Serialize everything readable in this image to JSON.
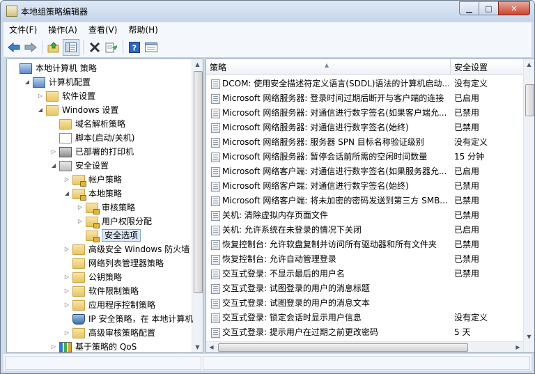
{
  "window": {
    "title": "本地组策略编辑器"
  },
  "menu": [
    "文件(F)",
    "操作(A)",
    "查看(V)",
    "帮助(H)"
  ],
  "toolbar": {
    "icons": [
      "back-arrow-icon",
      "forward-arrow-icon",
      "up-folder-icon",
      "show-hide-tree-icon",
      "delete-icon",
      "export-list-icon",
      "help-icon",
      "properties-view-icon"
    ]
  },
  "tree": [
    {
      "label": "本地计算机 策略",
      "level": 0,
      "icon": "computer",
      "toggle": ""
    },
    {
      "label": "计算机配置",
      "level": 1,
      "icon": "computer",
      "toggle": "◢"
    },
    {
      "label": "软件设置",
      "level": 2,
      "icon": "folder",
      "toggle": "▷"
    },
    {
      "label": "Windows 设置",
      "level": 2,
      "icon": "folder",
      "toggle": "◢"
    },
    {
      "label": "域名解析策略",
      "level": 3,
      "icon": "folder",
      "toggle": ""
    },
    {
      "label": "脚本(启动/关机)",
      "level": 3,
      "icon": "doc",
      "toggle": ""
    },
    {
      "label": "已部署的打印机",
      "level": 3,
      "icon": "printer",
      "toggle": "▷"
    },
    {
      "label": "安全设置",
      "level": 3,
      "icon": "lockdoc",
      "toggle": "◢"
    },
    {
      "label": "帐户策略",
      "level": 4,
      "icon": "lockfolder",
      "toggle": "▷"
    },
    {
      "label": "本地策略",
      "level": 4,
      "icon": "lockfolder",
      "toggle": "◢"
    },
    {
      "label": "审核策略",
      "level": 5,
      "icon": "lockfolder",
      "toggle": "▷"
    },
    {
      "label": "用户权限分配",
      "level": 5,
      "icon": "lockfolder",
      "toggle": "▷"
    },
    {
      "label": "安全选项",
      "level": 5,
      "icon": "lockfolder",
      "toggle": "",
      "selected": true
    },
    {
      "label": "高级安全 Windows 防火墙",
      "level": 4,
      "icon": "folder",
      "toggle": "▷"
    },
    {
      "label": "网络列表管理器策略",
      "level": 4,
      "icon": "folder",
      "toggle": ""
    },
    {
      "label": "公钥策略",
      "level": 4,
      "icon": "folder",
      "toggle": "▷"
    },
    {
      "label": "软件限制策略",
      "level": 4,
      "icon": "folder",
      "toggle": "▷"
    },
    {
      "label": "应用程序控制策略",
      "level": 4,
      "icon": "folder",
      "toggle": "▷"
    },
    {
      "label": "IP 安全策略，在 本地计算机",
      "level": 4,
      "icon": "shield",
      "toggle": ""
    },
    {
      "label": "高级审核策略配置",
      "level": 4,
      "icon": "folder",
      "toggle": "▷"
    },
    {
      "label": "基于策略的 QoS",
      "level": 3,
      "icon": "chart",
      "toggle": "▷"
    }
  ],
  "list": {
    "columns": {
      "policy": "策略",
      "setting": "安全设置"
    },
    "rows": [
      {
        "policy": "DCOM: 使用安全描述符定义语言(SDDL)语法的计算机启动...",
        "setting": "没有定义"
      },
      {
        "policy": "Microsoft 网络服务器: 登录时间过期后断开与客户端的连接",
        "setting": "已启用"
      },
      {
        "policy": "Microsoft 网络服务器: 对通信进行数字签名(如果客户端允...",
        "setting": "已禁用"
      },
      {
        "policy": "Microsoft 网络服务器: 对通信进行数字签名(始终)",
        "setting": "已禁用"
      },
      {
        "policy": "Microsoft 网络服务器: 服务器 SPN 目标名称验证级别",
        "setting": "没有定义"
      },
      {
        "policy": "Microsoft 网络服务器: 暂停会话前所需的空闲时间数量",
        "setting": "15 分钟"
      },
      {
        "policy": "Microsoft 网络客户端: 对通信进行数字签名(如果服务器允...",
        "setting": "已启用"
      },
      {
        "policy": "Microsoft 网络客户端: 对通信进行数字签名(始终)",
        "setting": "已禁用"
      },
      {
        "policy": "Microsoft 网络客户端: 将未加密的密码发送到第三方 SMB...",
        "setting": "已禁用"
      },
      {
        "policy": "关机: 清除虚拟内存页面文件",
        "setting": "已禁用"
      },
      {
        "policy": "关机: 允许系统在未登录的情况下关闭",
        "setting": "已启用"
      },
      {
        "policy": "恢复控制台: 允许软盘复制并访问所有驱动器和所有文件夹",
        "setting": "已禁用"
      },
      {
        "policy": "恢复控制台: 允许自动管理登录",
        "setting": "已禁用"
      },
      {
        "policy": "交互式登录: 不显示最后的用户名",
        "setting": "已禁用"
      },
      {
        "policy": "交互式登录: 试图登录的用户的消息标题",
        "setting": ""
      },
      {
        "policy": "交互式登录: 试图登录的用户的消息文本",
        "setting": ""
      },
      {
        "policy": "交互式登录: 锁定会话时显示用户信息",
        "setting": "没有定义"
      },
      {
        "policy": "交互式登录: 提示用户在过期之前更改密码",
        "setting": "5 天"
      }
    ]
  }
}
